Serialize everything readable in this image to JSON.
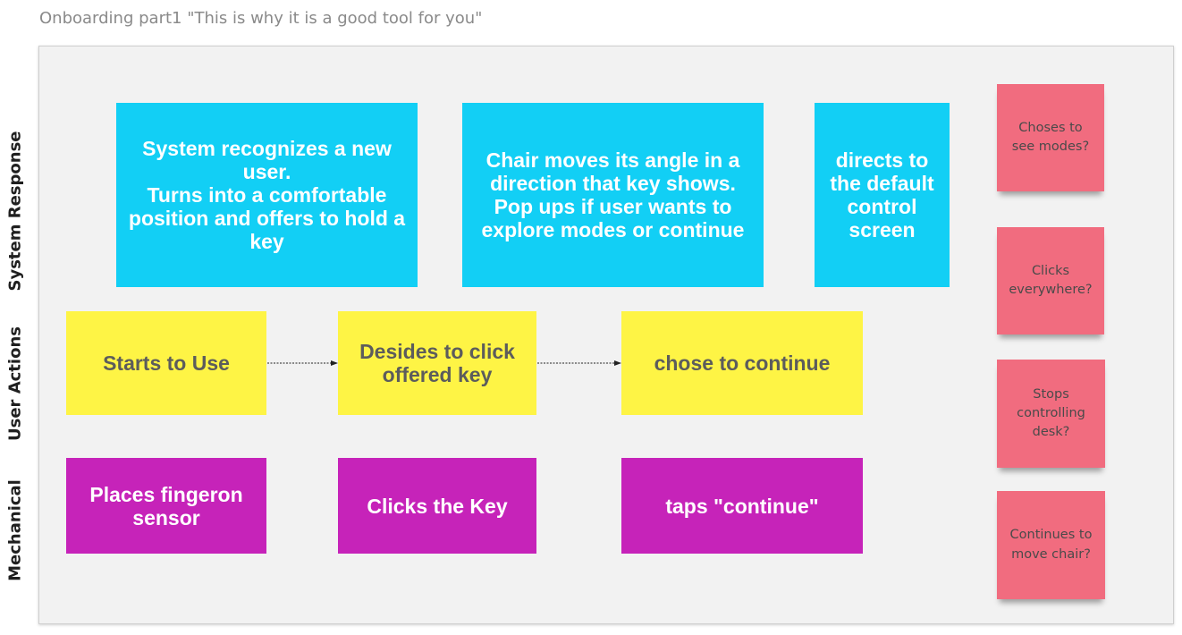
{
  "frame": {
    "title": "Onboarding part1 \"This is why it is a good tool for you\""
  },
  "row_labels": {
    "system_response": "System Response",
    "user_actions": "User Actions",
    "mechanical": "Mechanical"
  },
  "system_response": [
    "System recognizes a new user.\nTurns into a comfortable position and offers to hold a key",
    "Chair moves its angle in a direction that key shows. Pop ups if user wants to explore modes or continue",
    "directs to the default control screen"
  ],
  "user_actions": [
    "Starts to Use",
    "Desides to click offered key",
    "chose to continue"
  ],
  "mechanical": [
    "Places fingeron sensor",
    "Clicks the Key",
    "taps \"continue\""
  ],
  "questions": [
    "Choses to see modes?",
    "Clicks everywhere?",
    "Stops controlling desk?",
    "Continues to move chair?"
  ],
  "colors": {
    "system_response": "#12cff5",
    "user_actions": "#fef445",
    "mechanical": "#c623b9",
    "questions": "#f16c7f",
    "frame_background": "#f2f2f2"
  }
}
